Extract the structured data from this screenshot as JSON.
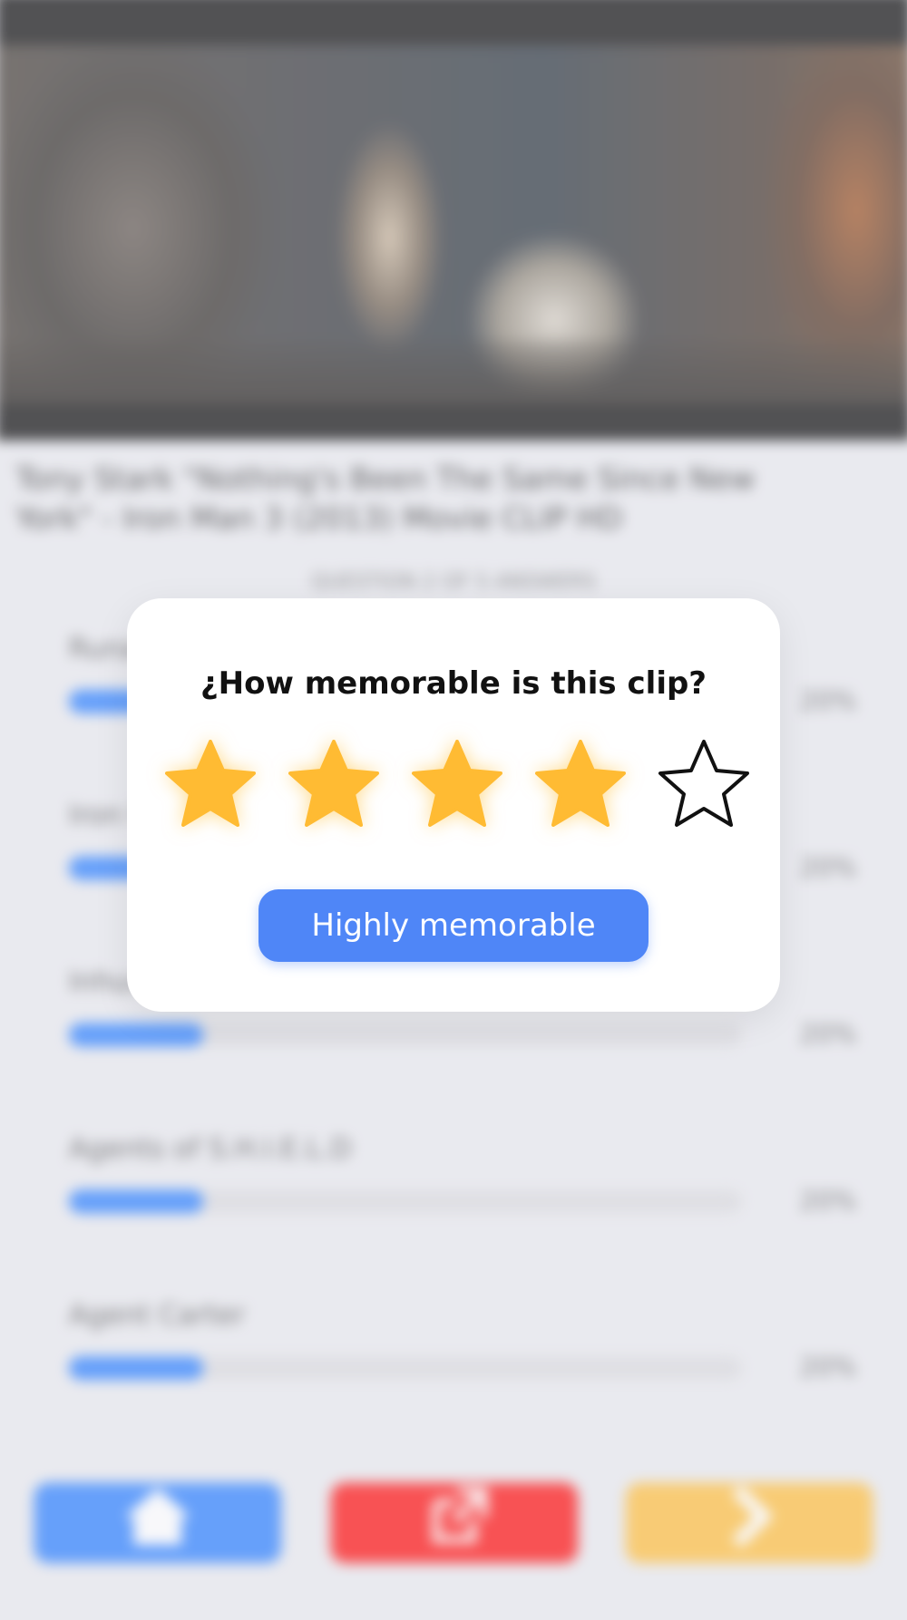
{
  "video": {
    "title": "Tony Stark \"Nothing's Been The Same Since New York\" - Iron Man 3 (2013) Movie CLIP HD",
    "progress_fraction": 0.16
  },
  "quiz": {
    "subheading": "QUESTION 2 OF 5 ANSWERS",
    "options": [
      {
        "label": "Runaways",
        "percent": "20%",
        "fraction": 0.2
      },
      {
        "label": "Iron Fist",
        "percent": "20%",
        "fraction": 0.2
      },
      {
        "label": "Inhumans",
        "percent": "20%",
        "fraction": 0.2
      },
      {
        "label": "Agents of S.H.I.E.L.D",
        "percent": "20%",
        "fraction": 0.2
      },
      {
        "label": "Agent Carter",
        "percent": "20%",
        "fraction": 0.2
      }
    ]
  },
  "bottom_nav": {
    "home_icon": "home-icon",
    "share_icon": "share-icon",
    "next_icon": "chevron-right-icon",
    "colors": {
      "home": "#1f78ff",
      "share": "#ff0000",
      "next": "#ffbb33"
    }
  },
  "rating_modal": {
    "question": "¿How memorable is this clip?",
    "rating": 4,
    "max_rating": 5,
    "button_label": "Highly memorable",
    "colors": {
      "star": "#ffbb33",
      "button": "#4f86f7"
    }
  }
}
